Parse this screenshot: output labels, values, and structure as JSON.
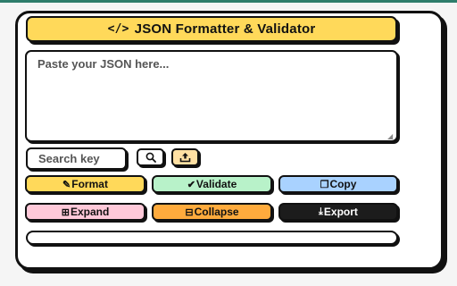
{
  "app": {
    "title": "JSON Formatter & Validator",
    "title_icon": "</>"
  },
  "editor": {
    "placeholder": "Paste your JSON here...",
    "value": ""
  },
  "search": {
    "placeholder": "Search key",
    "value": "",
    "search_icon": "search-icon",
    "upload_icon": "upload-icon"
  },
  "actions": {
    "format": {
      "label": "Format",
      "icon": "✎"
    },
    "validate": {
      "label": "Validate",
      "icon": "✔"
    },
    "copy": {
      "label": "Copy",
      "icon": "❐"
    },
    "expand": {
      "label": "Expand",
      "icon": "⊞"
    },
    "collapse": {
      "label": "Collapse",
      "icon": "⊟"
    },
    "export": {
      "label": "Export",
      "icon": "⤓"
    }
  },
  "colors": {
    "title_bg": "#ffd95a",
    "format_bg": "#ffd95a",
    "validate_bg": "#b8f2c9",
    "copy_bg": "#a9d2ff",
    "expand_bg": "#ffc9d9",
    "collapse_bg": "#ffab3d",
    "export_bg": "#1c1c1c",
    "upload_bg": "#ffe0a3"
  }
}
